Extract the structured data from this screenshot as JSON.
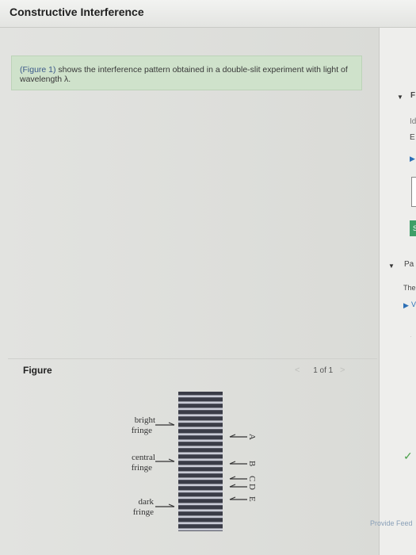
{
  "header": {
    "title": "Constructive Interference"
  },
  "notice": {
    "figure_ref": "(Figure 1)",
    "text": " shows the interference pattern obtained in a double-slit experiment with light of wavelength λ."
  },
  "figure": {
    "label": "Figure",
    "pager": {
      "prev": "<",
      "count": "1 of 1",
      "next": ">"
    },
    "left_labels": {
      "bright_1": "bright",
      "bright_2": "fringe",
      "central_1": "central",
      "central_2": "fringe",
      "dark_1": "dark",
      "dark_2": "fringe"
    },
    "markers": [
      "A",
      "B",
      "C",
      "D",
      "E"
    ]
  },
  "right_pane": {
    "part_f": "F",
    "id": "Id",
    "e": "E",
    "s": "S",
    "part_a": "Pa",
    "the": "The",
    "v": "V",
    "check": "✓",
    "provide_feedback": "Provide Feed"
  },
  "colors": {
    "notice_bg": "#cfe2cb",
    "link": "#3d5a8a",
    "accent_green": "#3f9e67"
  }
}
